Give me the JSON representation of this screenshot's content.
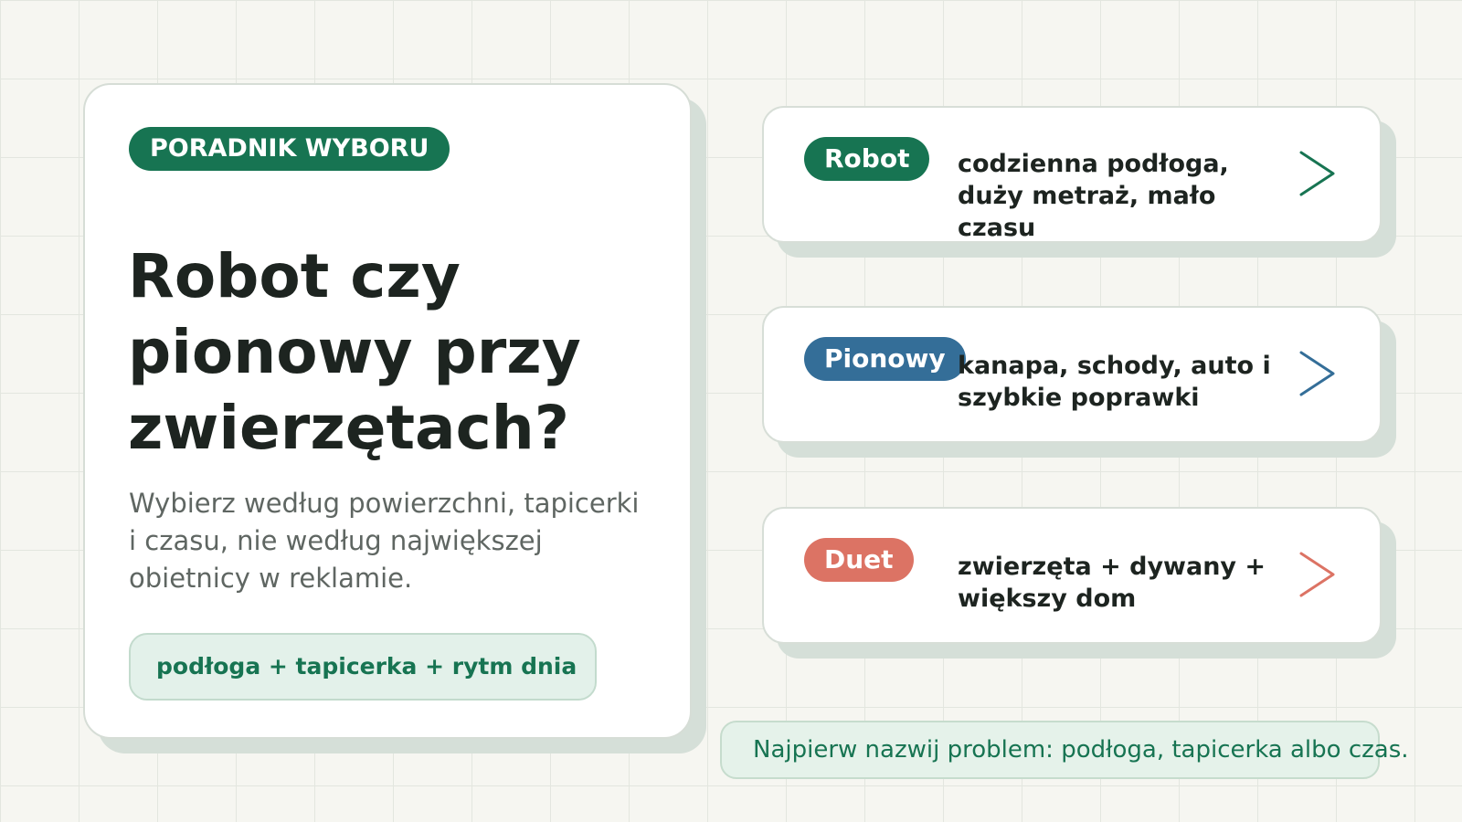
{
  "guide": {
    "kicker": "PORADNIK WYBORU",
    "title": "Robot czy pionowy przy zwierzętach?",
    "subtitle": "Wybierz według powierzchni, tapicerki i czasu, nie według największej obietnicy w reklamie.",
    "formula": "podłoga + tapicerka + rytm dnia"
  },
  "options": [
    {
      "tag": "Robot",
      "text": "codzienna podłoga, duży metraż, mało czasu",
      "color": "#177452",
      "icon": "chevron-right-icon"
    },
    {
      "tag": "Pionowy",
      "text": "kanapa, schody, auto i szybkie poprawki",
      "color": "#346e98",
      "icon": "chevron-right-icon"
    },
    {
      "tag": "Duet",
      "text": "zwierzęta + dywany + większy dom",
      "color": "#dc7364",
      "icon": "chevron-right-icon"
    }
  ],
  "tip": "Najpierw nazwij problem: podłoga, tapicerka albo czas.",
  "colors": {
    "background": "#f6f6f1",
    "accent_green": "#177452",
    "accent_blue": "#346e98",
    "accent_coral": "#dc7364",
    "text_dark": "#1d2420",
    "text_muted": "#5f6662"
  }
}
